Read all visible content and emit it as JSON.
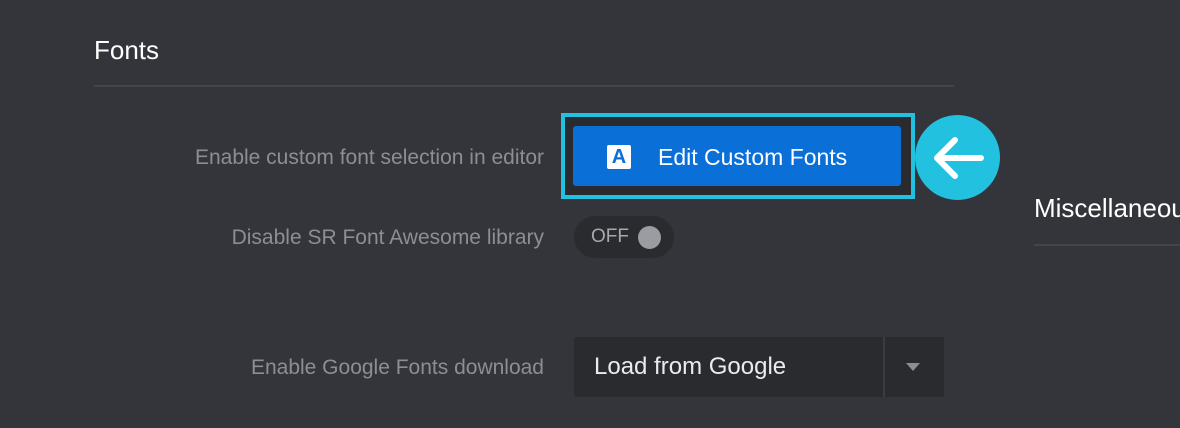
{
  "fonts_section": {
    "title": "Fonts"
  },
  "misc_section": {
    "title": "Miscellaneous"
  },
  "rows": {
    "custom_font": {
      "label": "Enable custom font selection in editor",
      "button_label": "Edit Custom Fonts",
      "button_icon": "font-a-icon",
      "icon_glyph": "A"
    },
    "font_awesome": {
      "label": "Disable SR Font Awesome library",
      "toggle_state": "OFF"
    },
    "google_fonts": {
      "label": "Enable Google Fonts download",
      "selected_value": "Load from Google"
    }
  },
  "colors": {
    "background": "#34353a",
    "button_blue": "#0a6fd7",
    "highlight_cyan": "#23c1e0",
    "label_gray": "#8d8e93"
  },
  "annotation": {
    "icon": "arrow-left-icon"
  }
}
